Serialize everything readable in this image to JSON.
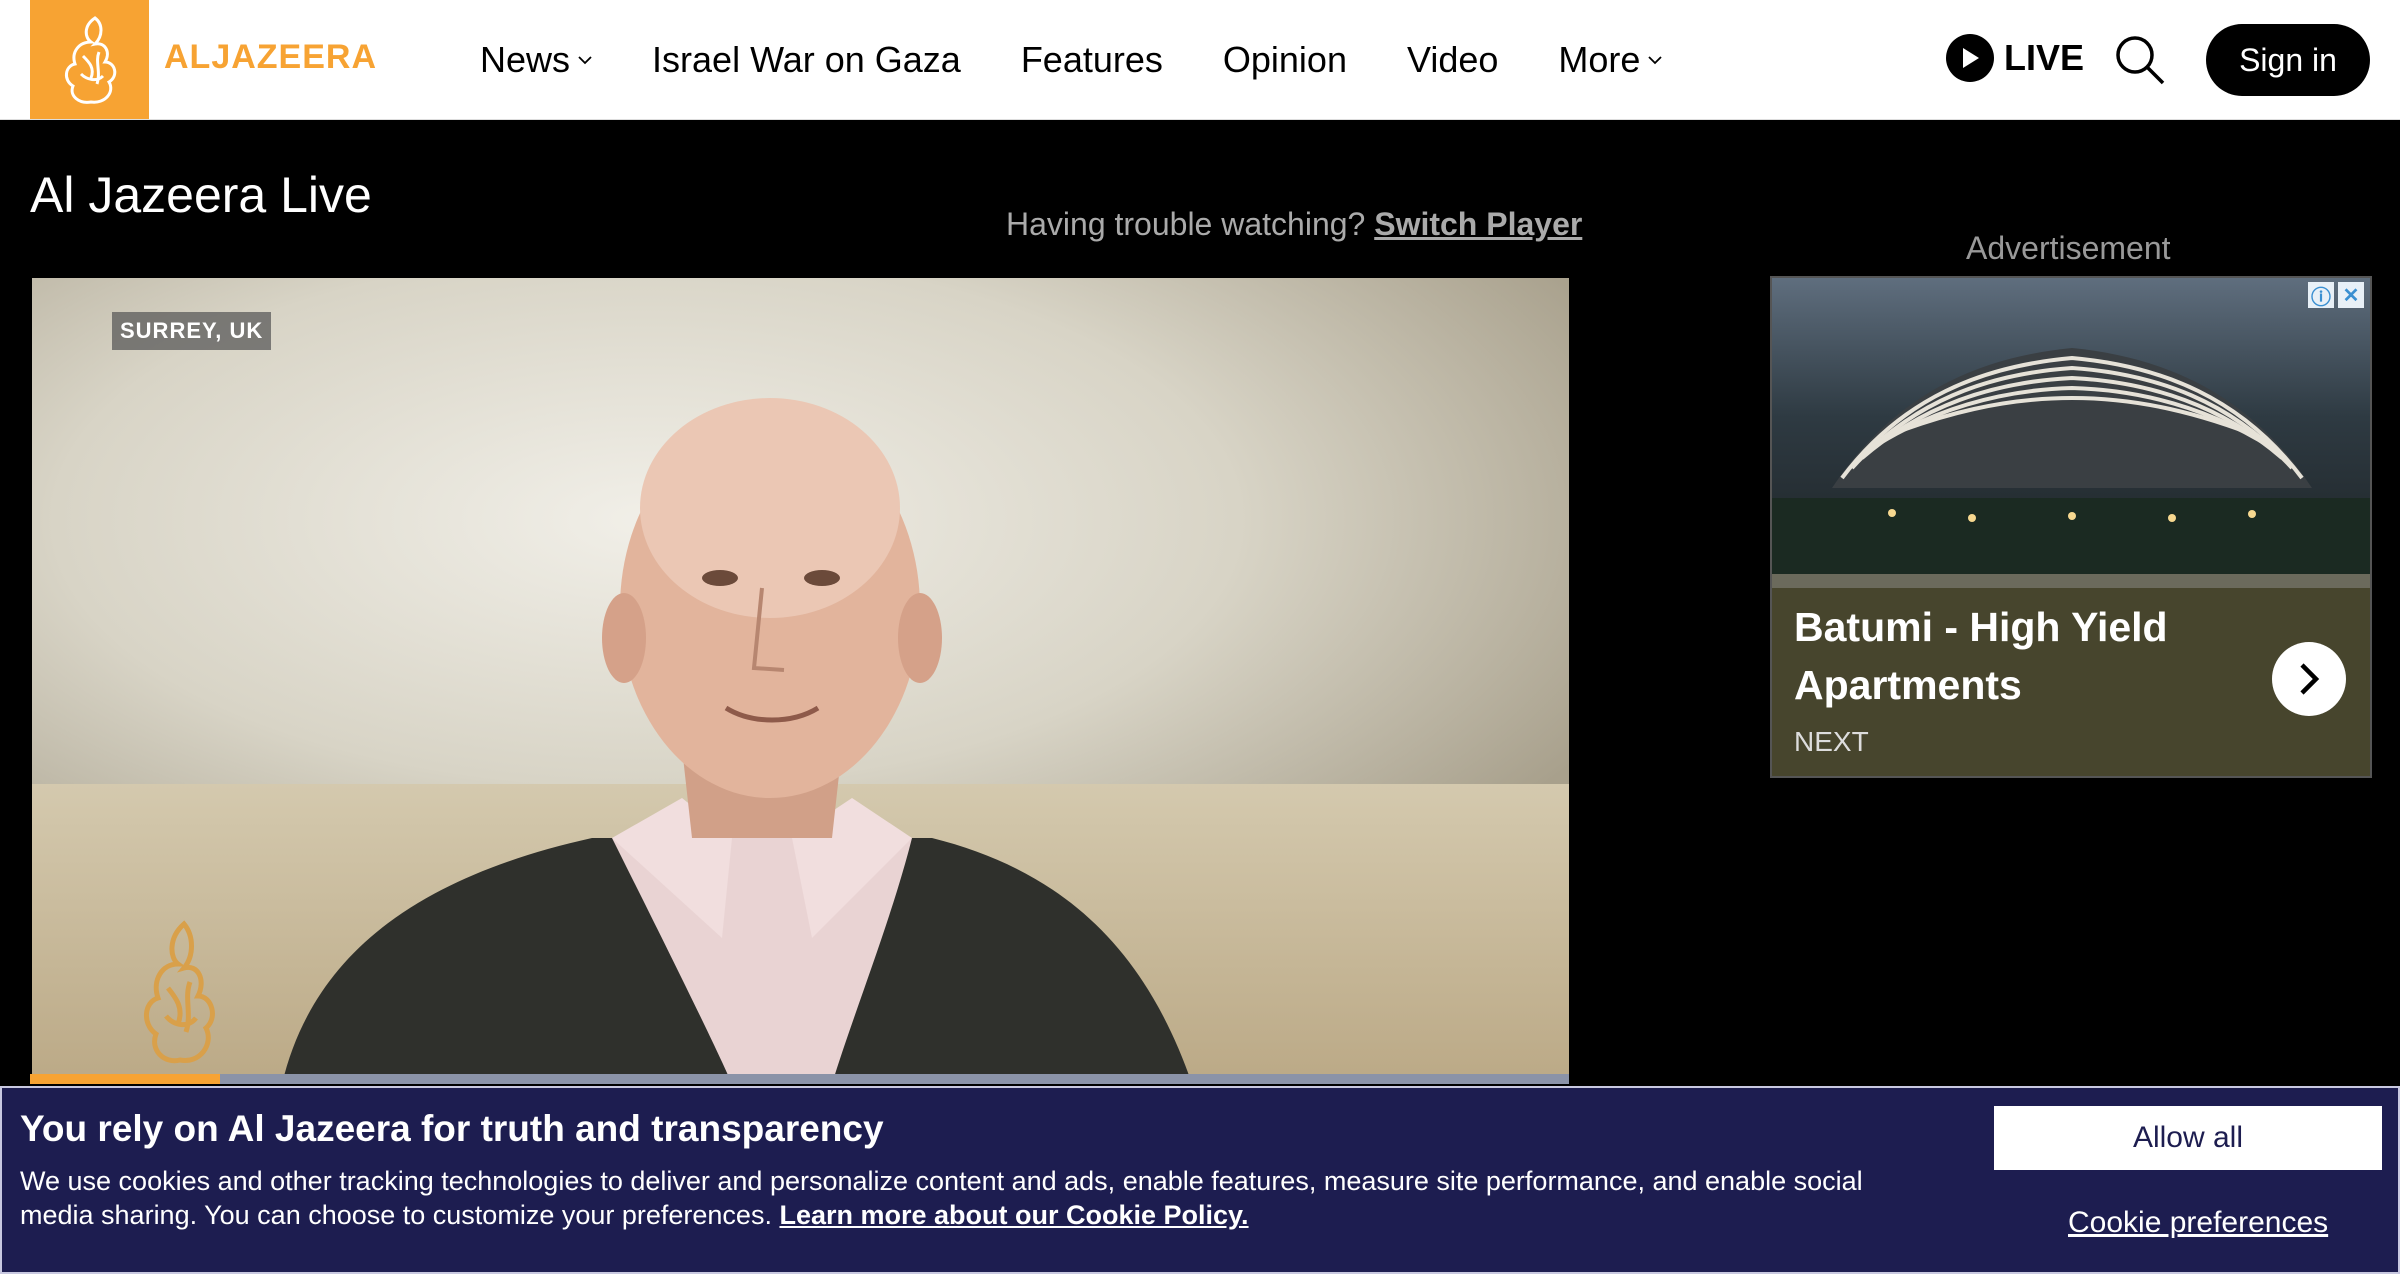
{
  "brand": {
    "logo_text": "ALJAZEERA",
    "accent": "#f7a333"
  },
  "nav": {
    "items": [
      {
        "label": "News",
        "dropdown": true
      },
      {
        "label": "Israel War on Gaza",
        "dropdown": false
      },
      {
        "label": "Features",
        "dropdown": false
      },
      {
        "label": "Opinion",
        "dropdown": false
      },
      {
        "label": "Video",
        "dropdown": false
      },
      {
        "label": "More",
        "dropdown": true
      }
    ],
    "live_label": "LIVE",
    "signin_label": "Sign in"
  },
  "page": {
    "title": "Al Jazeera Live",
    "trouble_text": "Having trouble watching?",
    "switch_player": "Switch Player"
  },
  "video": {
    "location": "SURREY, UK"
  },
  "ad": {
    "label": "Advertisement",
    "headline": "Batumi - High Yield Apartments",
    "next": "NEXT"
  },
  "cookie": {
    "title": "You rely on Al Jazeera for truth and transparency",
    "body": "We use cookies and other tracking technologies to deliver and personalize content and ads, enable features, measure site performance, and enable social media sharing. You can choose to customize your preferences.",
    "policy_link": "Learn more about our Cookie Policy.",
    "allow_all": "Allow all",
    "preferences": "Cookie preferences"
  }
}
